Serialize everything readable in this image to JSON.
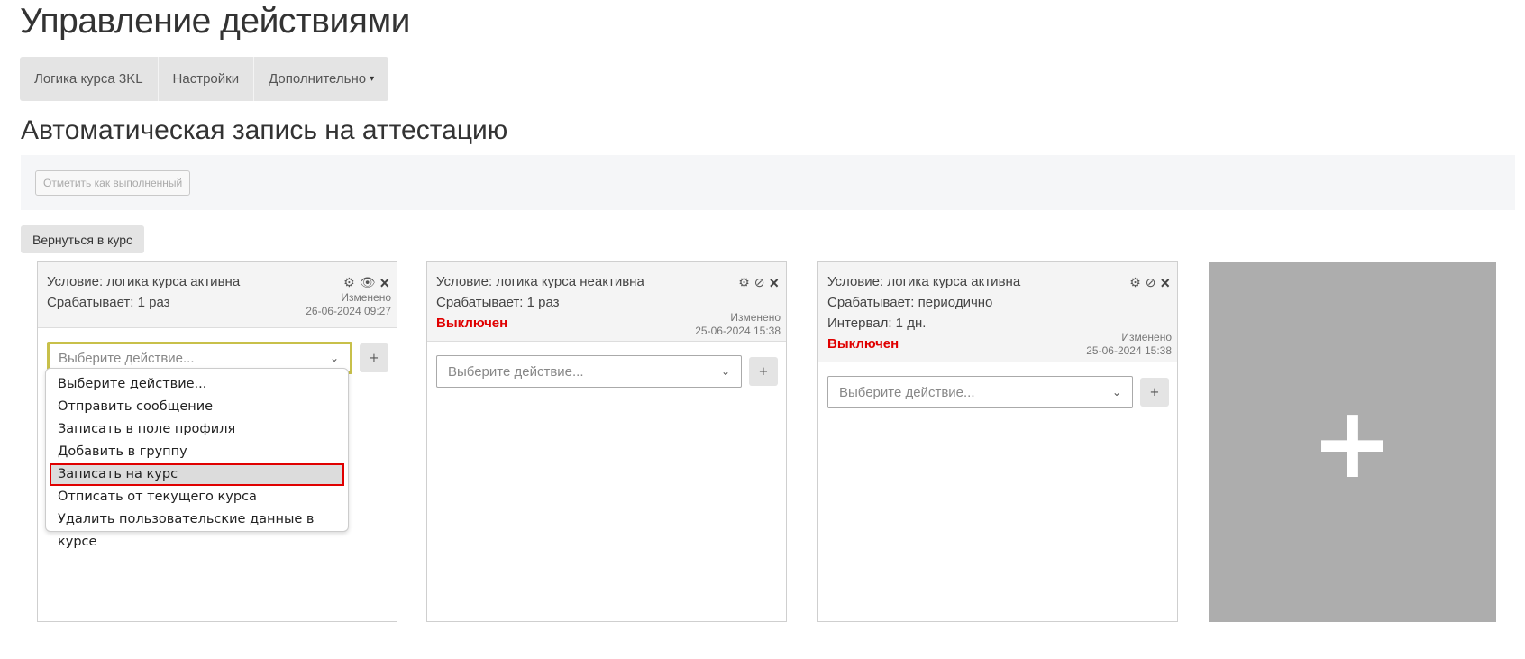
{
  "page": {
    "title": "Управление действиями",
    "section_title": "Автоматическая запись на аттестацию"
  },
  "tabs": [
    {
      "label": "Логика курса 3KL"
    },
    {
      "label": "Настройки"
    },
    {
      "label": "Дополнительно"
    }
  ],
  "toolbar": {
    "mark_done_label": "Отметить как выполненный",
    "back_label": "Вернуться в курс"
  },
  "cards": [
    {
      "condition": "Условие: логика курса активна",
      "trigger": "Срабатывает: 1 раз",
      "modified_label": "Изменено",
      "modified_date": "26-06-2024 09:27",
      "select_placeholder": "Выберите действие...",
      "add_label": "+"
    },
    {
      "condition": "Условие: логика курса неактивна",
      "trigger": "Срабатывает: 1 раз",
      "status": "Выключен",
      "modified_label": "Изменено",
      "modified_date": "25-06-2024 15:38",
      "select_placeholder": "Выберите действие...",
      "add_label": "+"
    },
    {
      "condition": "Условие: логика курса активна",
      "trigger": "Срабатывает: периодично",
      "interval": "Интервал: 1 дн.",
      "status": "Выключен",
      "modified_label": "Изменено",
      "modified_date": "25-06-2024 15:38",
      "select_placeholder": "Выберите действие...",
      "add_label": "+"
    }
  ],
  "dropdown": {
    "options": [
      "Выберите действие...",
      "Отправить сообщение",
      "Записать в поле профиля",
      "Добавить в группу",
      "Записать на курс",
      "Отписать от текущего курса",
      "Удалить пользовательские данные в курсе"
    ],
    "highlighted": "Записать на курс"
  },
  "colors": {
    "status_off": "#e00000",
    "focus_border": "#c8c04a",
    "add_card_bg": "#adadad"
  }
}
